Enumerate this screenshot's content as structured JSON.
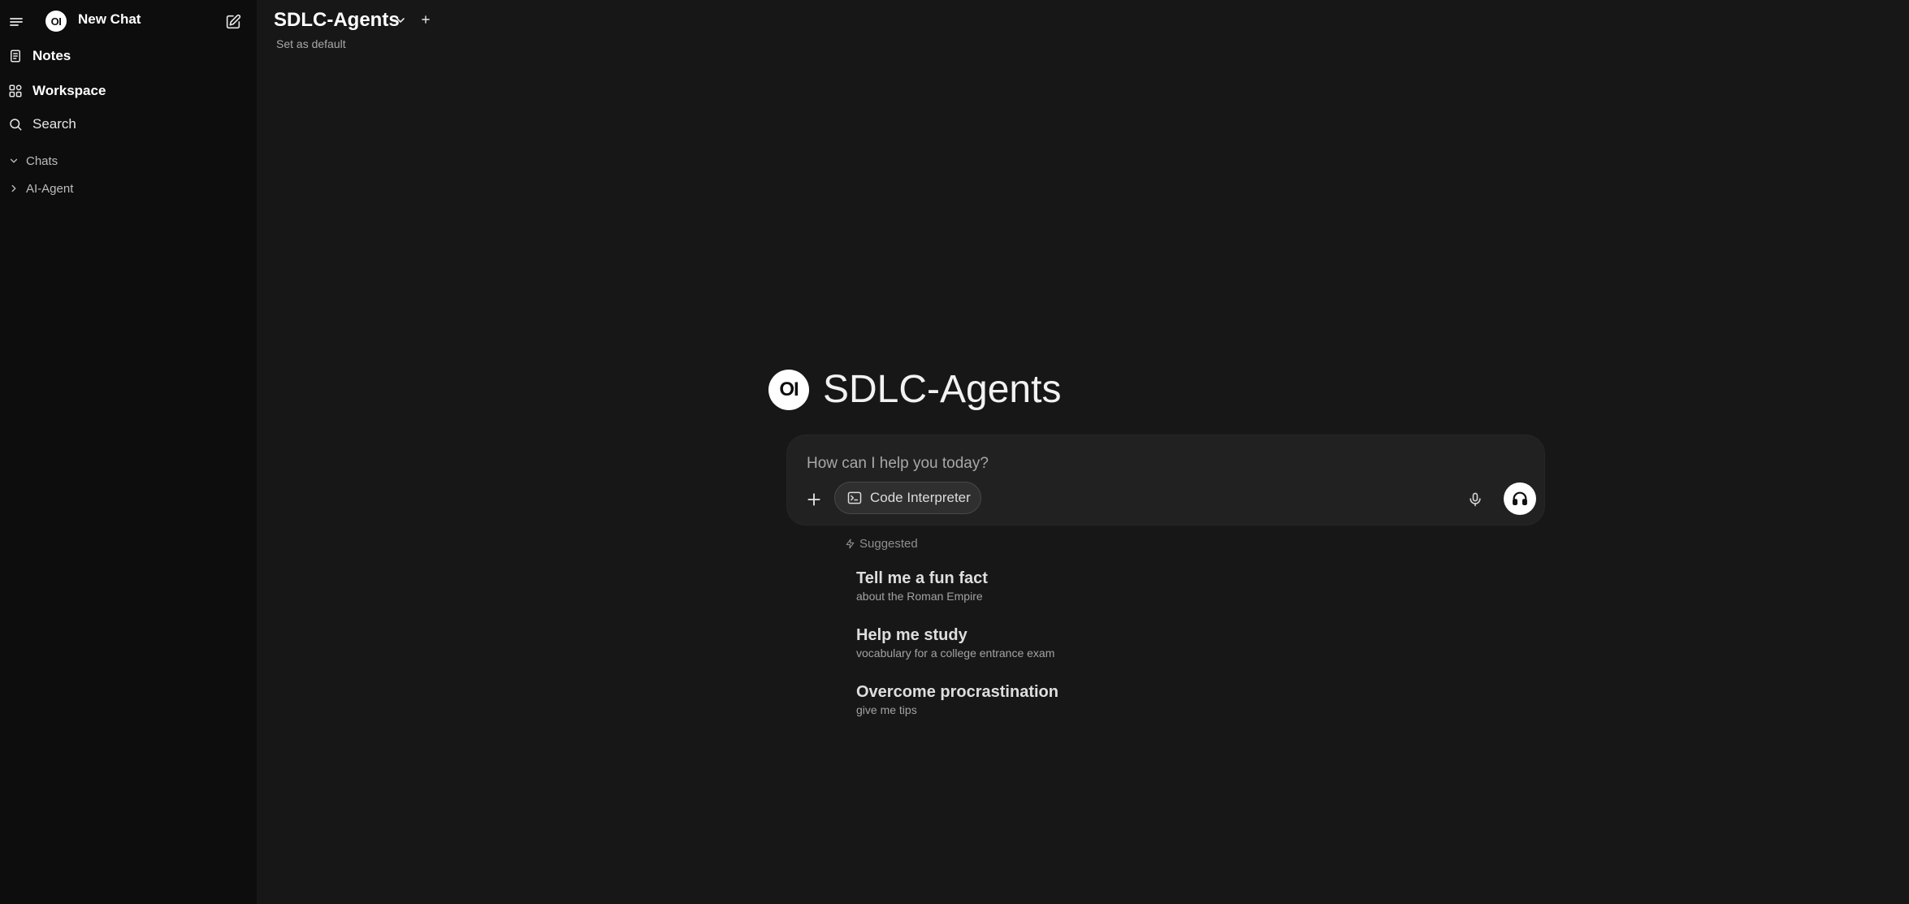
{
  "sidebar": {
    "logo_text": "OI",
    "new_chat_label": "New Chat",
    "items": [
      {
        "label": "Notes",
        "icon": "notes-icon"
      },
      {
        "label": "Workspace",
        "icon": "workspace-icon"
      },
      {
        "label": "Search",
        "icon": "search-icon"
      }
    ],
    "folders": [
      {
        "label": "Chats",
        "icon": "chevron-down-icon",
        "expanded": true
      },
      {
        "label": "AI-Agent",
        "icon": "chevron-right-icon",
        "expanded": false
      }
    ]
  },
  "header": {
    "model_name": "SDLC-Agents",
    "set_default_label": "Set as default"
  },
  "hero": {
    "logo_text": "OI",
    "title": "SDLC-Agents"
  },
  "composer": {
    "placeholder": "How can I help you today?",
    "value": "",
    "tool_label": "Code Interpreter"
  },
  "suggestions": {
    "heading": "Suggested",
    "items": [
      {
        "title": "Tell me a fun fact",
        "subtitle": "about the Roman Empire"
      },
      {
        "title": "Help me study",
        "subtitle": "vocabulary for a college entrance exam"
      },
      {
        "title": "Overcome procrastination",
        "subtitle": "give me tips"
      }
    ]
  },
  "colors": {
    "sidebar_bg": "#0d0d0d",
    "main_bg": "#171717",
    "composer_bg": "#212121",
    "text_primary": "#ffffff",
    "text_muted": "#a8a8a8"
  }
}
